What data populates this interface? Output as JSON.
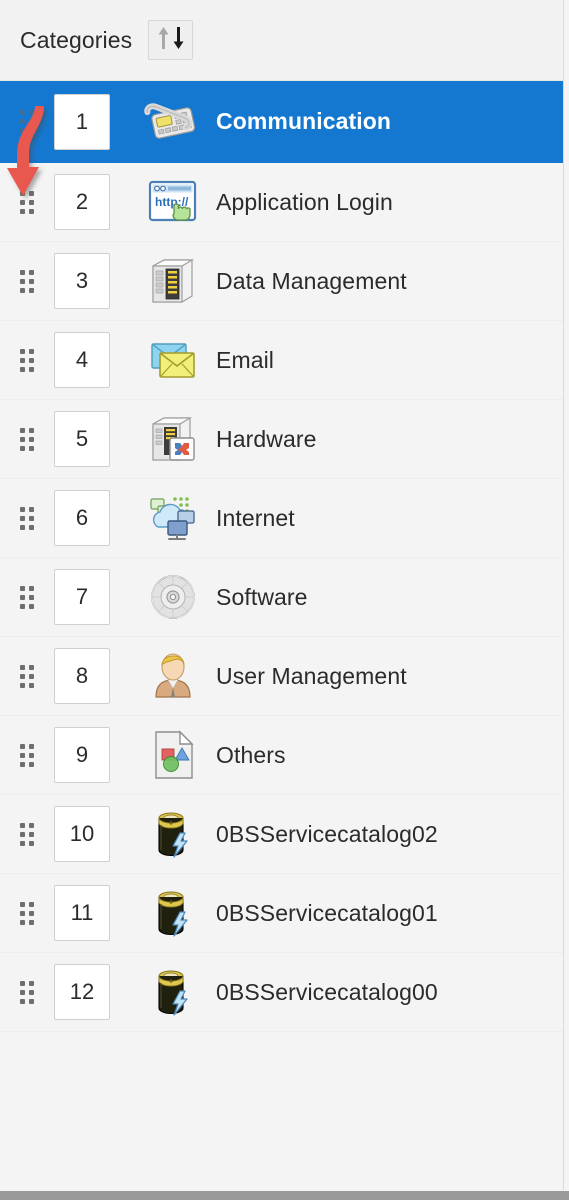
{
  "header": {
    "title": "Categories",
    "sort_button": {
      "name": "sort-toggle",
      "up_arrow": "arrow-up-icon",
      "down_arrow": "arrow-down-icon",
      "up_color": "#a8a8a8",
      "down_color": "#1a1a1a"
    }
  },
  "theme": {
    "background": "#f4f4f4",
    "selected_row": "#1478d0",
    "selected_text": "#ffffff",
    "text": "#2b2b2b",
    "row_divider": "#ededed",
    "box_border": "#cfcfcf",
    "annotation": "#e8584f"
  },
  "annotation": {
    "type": "curved-arrow",
    "color": "#e8584f",
    "direction": "down-left",
    "points_to": "row-2-drag-handle"
  },
  "list": {
    "selected_index": 0,
    "rows": [
      {
        "order": "1",
        "label": "Communication",
        "icon": "desk-phone-icon",
        "selected": true
      },
      {
        "order": "2",
        "label": "Application Login",
        "icon": "browser-http-icon",
        "selected": false
      },
      {
        "order": "3",
        "label": "Data Management",
        "icon": "server-tower-icon",
        "selected": false
      },
      {
        "order": "4",
        "label": "Email",
        "icon": "envelope-icon",
        "selected": false
      },
      {
        "order": "5",
        "label": "Hardware",
        "icon": "server-network-icon",
        "selected": false
      },
      {
        "order": "6",
        "label": "Internet",
        "icon": "cloud-network-icon",
        "selected": false
      },
      {
        "order": "7",
        "label": "Software",
        "icon": "compact-disc-icon",
        "selected": false
      },
      {
        "order": "8",
        "label": "User Management",
        "icon": "user-person-icon",
        "selected": false
      },
      {
        "order": "9",
        "label": "Others",
        "icon": "document-shapes-icon",
        "selected": false
      },
      {
        "order": "10",
        "label": "0BSServicecatalog02",
        "icon": "battery-bolt-icon",
        "selected": false
      },
      {
        "order": "11",
        "label": "0BSServicecatalog01",
        "icon": "battery-bolt-icon",
        "selected": false
      },
      {
        "order": "12",
        "label": "0BSServicecatalog00",
        "icon": "battery-bolt-icon",
        "selected": false
      }
    ]
  }
}
